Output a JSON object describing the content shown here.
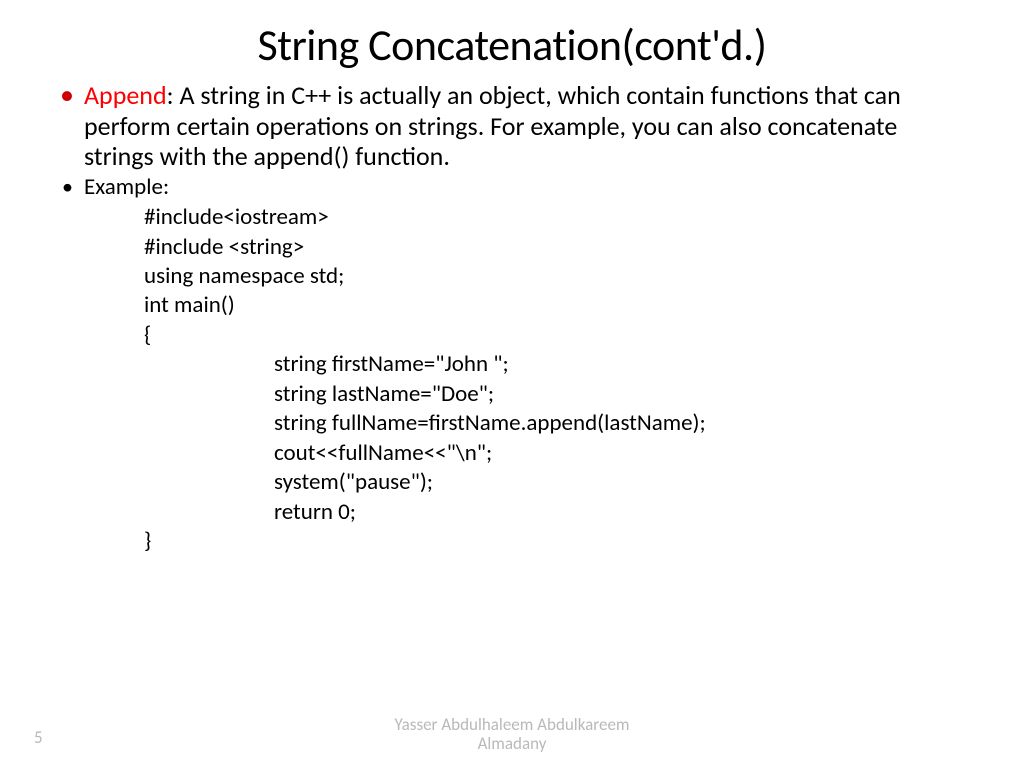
{
  "title": "String Concatenation(cont'd.)",
  "bullet1": {
    "keyword": "Append",
    "rest": ": A string in C++ is actually an object, which contain functions that can perform certain operations on strings. For example, you can also concatenate strings with the append() function."
  },
  "bullet2": "Example:",
  "code": {
    "l1": "#include<iostream>",
    "l2": "#include <string>",
    "l3": "using namespace std;",
    "l4": "int main()",
    "l5": "{",
    "l6": "string firstName=\"John \";",
    "l7": "string lastName=\"Doe\";",
    "l8": "string fullName=firstName.append(lastName);",
    "l9": "cout<<fullName<<\"\\n\";",
    "l10": "system(\"pause\");",
    "l11": "return 0;",
    "l12": "}"
  },
  "footer": {
    "author_line1": "Yasser Abdulhaleem Abdulkareem",
    "author_line2": "Almadany",
    "page": "5"
  }
}
